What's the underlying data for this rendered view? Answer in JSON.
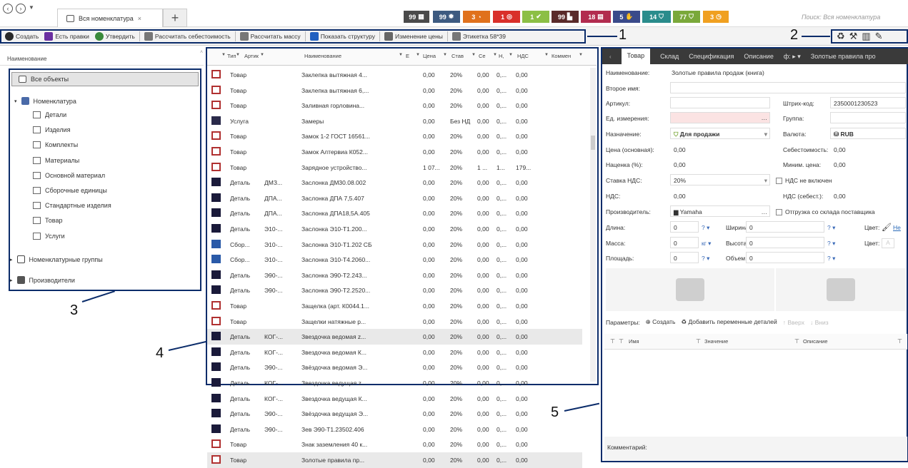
{
  "top": {
    "tab_title": "Вся номенклатура",
    "tab_close": "×",
    "tab_add": "+",
    "badges": [
      {
        "count": "99",
        "color": "#4a4a4a",
        "icon": "grid-icon"
      },
      {
        "count": "99",
        "color": "#3d5a80",
        "icon": "sun-icon"
      },
      {
        "count": "3",
        "color": "#e0711c",
        "icon": "cake-icon"
      },
      {
        "count": "1",
        "color": "#d9302a",
        "icon": "target-icon"
      },
      {
        "count": "1",
        "color": "#8cbf45",
        "icon": "check-icon"
      },
      {
        "count": "99",
        "color": "#5a2a2a",
        "icon": "chart-icon"
      },
      {
        "count": "18",
        "color": "#b22c4f",
        "icon": "calendar-icon"
      },
      {
        "count": "5",
        "color": "#3a4a8a",
        "icon": "hand-icon"
      },
      {
        "count": "14",
        "color": "#2a8c8c",
        "icon": "basket-icon"
      },
      {
        "count": "77",
        "color": "#7aa83a",
        "icon": "cart-icon"
      },
      {
        "count": "3",
        "color": "#f0a020",
        "icon": "clock-icon"
      }
    ],
    "search_placeholder": "Поиск: Вся номенклатура"
  },
  "toolbar": {
    "items": [
      {
        "label": "Создать",
        "icon": "plus-icon",
        "color": "#2a2a2a"
      },
      {
        "label": "Есть правки",
        "icon": "pencil-icon",
        "color": "#6a2fa0"
      },
      {
        "label": "Утвердить",
        "icon": "check-icon",
        "color": "#3a8a3a"
      },
      {
        "label": "Рассчитать себестоимость",
        "icon": "calculator-icon",
        "color": "#777"
      },
      {
        "label": "Рассчитать массу",
        "icon": "calculator-icon",
        "color": "#777"
      },
      {
        "label": "Показать структуру",
        "icon": "structure-icon",
        "color": "#2060c0"
      },
      {
        "label": "Изменение цены",
        "icon": "percent-icon",
        "color": "#666"
      },
      {
        "label": "Этикетка 58*39",
        "icon": "label-icon",
        "color": "#777"
      }
    ]
  },
  "callouts": {
    "c1": "1",
    "c2": "2",
    "c3": "3",
    "c4": "4",
    "c5": "5"
  },
  "tree": {
    "header": "Наименование",
    "root": "Все объекты",
    "nomenclature": "Номенклатура",
    "children": [
      "Детали",
      "Изделия",
      "Комплекты",
      "Материалы",
      "Основной материал",
      "Сборочные единицы",
      "Стандартные изделия",
      "Товар",
      "Услуги"
    ],
    "groups": "Номенклатурные группы",
    "makers": "Производители"
  },
  "grid": {
    "columns": [
      "Тип",
      "Артик",
      "Наименование",
      "Е",
      "Цена",
      "Став",
      "Се",
      "Н,",
      "НДС",
      "Коммен"
    ],
    "rows": [
      {
        "icon": "box",
        "type": "Товар",
        "art": "",
        "name": "Заклепка вытяжная 4...",
        "price": "0,00",
        "rate": "20%",
        "se": "0,00",
        "n": "0,...",
        "nds": "0,00"
      },
      {
        "icon": "box",
        "type": "Товар",
        "art": "",
        "name": "Заклепка вытяжная 6,...",
        "price": "0,00",
        "rate": "20%",
        "se": "0,00",
        "n": "0,...",
        "nds": "0,00"
      },
      {
        "icon": "box",
        "type": "Товар",
        "art": "",
        "name": "Заливная горловина...",
        "price": "0,00",
        "rate": "20%",
        "se": "0,00",
        "n": "0,...",
        "nds": "0,00"
      },
      {
        "icon": "wrench",
        "type": "Услуга",
        "art": "",
        "name": "Замеры",
        "price": "0,00",
        "rate": "Без НД",
        "se": "0,00",
        "n": "0,...",
        "nds": "0,00"
      },
      {
        "icon": "box",
        "type": "Товар",
        "art": "",
        "name": "Замок 1-2 ГОСТ 16561...",
        "price": "0,00",
        "rate": "20%",
        "se": "0,00",
        "n": "0,...",
        "nds": "0,00"
      },
      {
        "icon": "box",
        "type": "Товар",
        "art": "",
        "name": "Замок Алтервиа К052...",
        "price": "0,00",
        "rate": "20%",
        "se": "0,00",
        "n": "0,...",
        "nds": "0,00"
      },
      {
        "icon": "box",
        "type": "Товар",
        "art": "",
        "name": "Зарядное устройство...",
        "price": "1 07...",
        "rate": "20%",
        "se": "1 ...",
        "n": "1...",
        "nds": "179..."
      },
      {
        "icon": "part",
        "type": "Деталь",
        "art": "ДМЗ...",
        "name": "Заслонка ДМ30.08.002",
        "price": "0,00",
        "rate": "20%",
        "se": "0,00",
        "n": "0,...",
        "nds": "0,00"
      },
      {
        "icon": "part",
        "type": "Деталь",
        "art": "ДПА...",
        "name": "Заслонка ДПА 7,5.407",
        "price": "0,00",
        "rate": "20%",
        "se": "0,00",
        "n": "0,...",
        "nds": "0,00"
      },
      {
        "icon": "part",
        "type": "Деталь",
        "art": "ДПА...",
        "name": "Заслонка ДПА18,5А.405",
        "price": "0,00",
        "rate": "20%",
        "se": "0,00",
        "n": "0,...",
        "nds": "0,00"
      },
      {
        "icon": "part",
        "type": "Деталь",
        "art": "Э10-...",
        "name": "Заслонка Э10-Т1.200...",
        "price": "0,00",
        "rate": "20%",
        "se": "0,00",
        "n": "0,...",
        "nds": "0,00"
      },
      {
        "icon": "asm",
        "type": "Сбор...",
        "art": "Э10-...",
        "name": "Заслонка Э10-Т1.202 СБ",
        "price": "0,00",
        "rate": "20%",
        "se": "0,00",
        "n": "0,...",
        "nds": "0,00"
      },
      {
        "icon": "asm",
        "type": "Сбор...",
        "art": "Э10-...",
        "name": "Заслонка Э10-Т4.2060...",
        "price": "0,00",
        "rate": "20%",
        "se": "0,00",
        "n": "0,...",
        "nds": "0,00"
      },
      {
        "icon": "part",
        "type": "Деталь",
        "art": "Э90-...",
        "name": "Заслонка Э90-Т2.243...",
        "price": "0,00",
        "rate": "20%",
        "se": "0,00",
        "n": "0,...",
        "nds": "0,00"
      },
      {
        "icon": "part",
        "type": "Деталь",
        "art": "Э90-...",
        "name": "Заслонка Э90-Т2.2520...",
        "price": "0,00",
        "rate": "20%",
        "se": "0,00",
        "n": "0,...",
        "nds": "0,00"
      },
      {
        "icon": "box",
        "type": "Товар",
        "art": "",
        "name": "Защелка (арт. К0044.1...",
        "price": "0,00",
        "rate": "20%",
        "se": "0,00",
        "n": "0,...",
        "nds": "0,00"
      },
      {
        "icon": "box",
        "type": "Товар",
        "art": "",
        "name": "Защелки натяжные р...",
        "price": "0,00",
        "rate": "20%",
        "se": "0,00",
        "n": "0,...",
        "nds": "0,00"
      },
      {
        "icon": "part",
        "type": "Деталь",
        "art": "КОГ-...",
        "name": "Звездочка ведомая z...",
        "price": "0,00",
        "rate": "20%",
        "se": "0,00",
        "n": "0,...",
        "nds": "0,00",
        "sel": true
      },
      {
        "icon": "part",
        "type": "Деталь",
        "art": "КОГ-...",
        "name": "Звездочка ведомая К...",
        "price": "0,00",
        "rate": "20%",
        "se": "0,00",
        "n": "0,...",
        "nds": "0,00"
      },
      {
        "icon": "part",
        "type": "Деталь",
        "art": "Э90-...",
        "name": "Звёздочка ведомая Э...",
        "price": "0,00",
        "rate": "20%",
        "se": "0,00",
        "n": "0,...",
        "nds": "0,00"
      },
      {
        "icon": "part",
        "type": "Деталь",
        "art": "КОГ-...",
        "name": "Звездочка ведущая z...",
        "price": "0,00",
        "rate": "20%",
        "se": "0,00",
        "n": "0,...",
        "nds": "0,00"
      },
      {
        "icon": "part",
        "type": "Деталь",
        "art": "КОГ-...",
        "name": "Звездочка ведущая К...",
        "price": "0,00",
        "rate": "20%",
        "se": "0,00",
        "n": "0,...",
        "nds": "0,00"
      },
      {
        "icon": "part",
        "type": "Деталь",
        "art": "Э90-...",
        "name": "Звёздочка ведущая Э...",
        "price": "0,00",
        "rate": "20%",
        "se": "0,00",
        "n": "0,...",
        "nds": "0,00"
      },
      {
        "icon": "part",
        "type": "Деталь",
        "art": "Э90-...",
        "name": "Зев Э90-Т1.23502.406",
        "price": "0,00",
        "rate": "20%",
        "se": "0,00",
        "n": "0,...",
        "nds": "0,00"
      },
      {
        "icon": "box",
        "type": "Товар",
        "art": "",
        "name": "Знак заземления 40 к...",
        "price": "0,00",
        "rate": "20%",
        "se": "0,00",
        "n": "0,...",
        "nds": "0,00"
      },
      {
        "icon": "box",
        "type": "Товар",
        "art": "",
        "name": "Золотые правила пр...",
        "price": "0,00",
        "rate": "20%",
        "se": "0,00",
        "n": "0,...",
        "nds": "0,00",
        "sel": true
      }
    ]
  },
  "panel": {
    "tabs": [
      "Товар",
      "Склад",
      "Спецификация",
      "Описание",
      "Золотые правила про"
    ],
    "tab_more": "ф: ▸ ▾",
    "name_label": "Наименование:",
    "name_value": "Золотые правила продаж (книга)",
    "second_name_label": "Второе имя:",
    "article_label": "Артикул:",
    "barcode_label": "Штрих-код:",
    "barcode_value": "2350001230523",
    "unit_label": "Ед. измерения:",
    "group_label": "Группа:",
    "purpose_label": "Назначение:",
    "purpose_value": "Для продажи",
    "currency_label": "Валюта:",
    "currency_value": "RUB",
    "price_label": "Цена (основная):",
    "price_value": "0,00",
    "cost_label": "Себестоимость:",
    "cost_value": "0,00",
    "markup_label": "Наценка (%):",
    "markup_value": "0,00",
    "minprice_label": "Миним. цена:",
    "minprice_value": "0,00",
    "vat_rate_label": "Ставка НДС:",
    "vat_rate_value": "20%",
    "vat_incl_label": "НДС не включен",
    "vat_label": "НДС:",
    "vat_value": "0,00",
    "vat_cost_label": "НДС (себест.):",
    "vat_cost_value": "0,00",
    "maker_label": "Производитель:",
    "maker_value": "Yamaha",
    "ship_label": "Отгрузка со склада поставщика",
    "length_label": "Длина:",
    "length_value": "0",
    "width_label": "Ширина:",
    "width_value": "0",
    "color_label": "Цвет:",
    "color_value": "Не",
    "mass_label": "Масса:",
    "mass_value": "0",
    "mass_unit": "кг ▾",
    "height_label": "Высота:",
    "height_value": "0",
    "color2_label": "Цвет:",
    "area_label": "Площадь:",
    "area_value": "0",
    "volume_label": "Объем:",
    "volume_value": "0",
    "unit_q": "? ▾",
    "params_label": "Параметры:",
    "params_create": "Создать",
    "params_add": "Добавить переменные деталей",
    "params_up": "Вверх",
    "params_down": "Вниз",
    "pcol_name": "Имя",
    "pcol_value": "Значение",
    "pcol_desc": "Описание",
    "comment_label": "Комментарий:"
  }
}
